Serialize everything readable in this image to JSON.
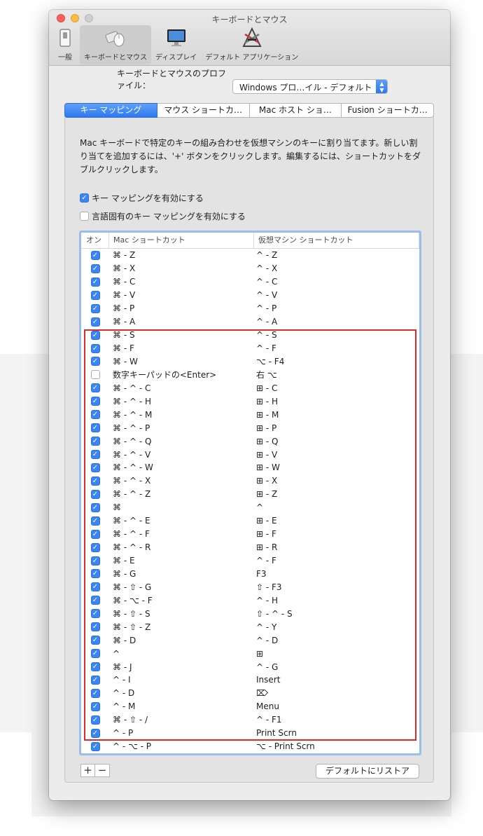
{
  "window": {
    "title": "キーボードとマウス"
  },
  "toolbar": {
    "items": [
      {
        "label": "一般",
        "icon": "general-switch-icon"
      },
      {
        "label": "キーボードとマウス",
        "icon": "keyboard-mouse-icon",
        "active": true
      },
      {
        "label": "ディスプレイ",
        "icon": "display-icon"
      },
      {
        "label": "デフォルト アプリケーション",
        "icon": "default-applications-icon"
      }
    ]
  },
  "profile": {
    "label": "キーボードとマウスのプロファイル：",
    "value": "Windows プロ…イル - デフォルト"
  },
  "tabs": [
    {
      "label": "キー マッピング",
      "selected": true
    },
    {
      "label": "マウス ショートカ…"
    },
    {
      "label": "Mac ホスト ショ…"
    },
    {
      "label": "Fusion ショートカ…"
    }
  ],
  "description": "Mac キーボードで特定のキーの組み合わせを仮想マシンのキーに割り当てます。新しい割り当てを追加するには、'+' ボタンをクリックします。編集するには、ショートカットをダブルクリックします。",
  "options": {
    "enable_mapping": {
      "label": "キー マッピングを有効にする",
      "checked": true
    },
    "enable_language": {
      "label": "言語固有のキー マッピングを有効にする",
      "checked": false
    }
  },
  "table": {
    "headers": {
      "on": "オン",
      "mac": "Mac ショートカット",
      "vm": "仮想マシン ショートカット"
    },
    "rows": [
      {
        "on": true,
        "mac": "⌘ - Z",
        "vm": "^ - Z"
      },
      {
        "on": true,
        "mac": "⌘ - X",
        "vm": "^ - X"
      },
      {
        "on": true,
        "mac": "⌘ - C",
        "vm": "^ - C"
      },
      {
        "on": true,
        "mac": "⌘ - V",
        "vm": "^ - V"
      },
      {
        "on": true,
        "mac": "⌘ - P",
        "vm": "^ - P"
      },
      {
        "on": true,
        "mac": "⌘ - A",
        "vm": "^ - A"
      },
      {
        "on": true,
        "mac": "⌘ - S",
        "vm": "^ - S"
      },
      {
        "on": true,
        "mac": "⌘ - F",
        "vm": "^ - F"
      },
      {
        "on": true,
        "mac": "⌘ - W",
        "vm": "⌥ - F4"
      },
      {
        "on": false,
        "mac": "数字キーパッドの<Enter>",
        "vm": "右 ⌥"
      },
      {
        "on": true,
        "mac": "⌘ - ^ - C",
        "vm": "⊞ - C"
      },
      {
        "on": true,
        "mac": "⌘ - ^ - H",
        "vm": "⊞ - H"
      },
      {
        "on": true,
        "mac": "⌘ - ^ - M",
        "vm": "⊞ - M"
      },
      {
        "on": true,
        "mac": "⌘ - ^ - P",
        "vm": "⊞ - P"
      },
      {
        "on": true,
        "mac": "⌘ - ^ - Q",
        "vm": "⊞ - Q"
      },
      {
        "on": true,
        "mac": "⌘ - ^ - V",
        "vm": "⊞ - V"
      },
      {
        "on": true,
        "mac": "⌘ - ^ - W",
        "vm": "⊞ - W"
      },
      {
        "on": true,
        "mac": "⌘ - ^ - X",
        "vm": "⊞ - X"
      },
      {
        "on": true,
        "mac": "⌘ - ^ - Z",
        "vm": "⊞ - Z"
      },
      {
        "on": true,
        "mac": "⌘",
        "vm": "^"
      },
      {
        "on": true,
        "mac": "⌘ - ^ - E",
        "vm": "⊞ - E"
      },
      {
        "on": true,
        "mac": "⌘ - ^ - F",
        "vm": "⊞ - F"
      },
      {
        "on": true,
        "mac": "⌘ - ^ - R",
        "vm": "⊞ - R"
      },
      {
        "on": true,
        "mac": "⌘ - E",
        "vm": "^ - F"
      },
      {
        "on": true,
        "mac": "⌘ - G",
        "vm": "F3"
      },
      {
        "on": true,
        "mac": "⌘ - ⇧ - G",
        "vm": "⇧ - F3"
      },
      {
        "on": true,
        "mac": "⌘ - ⌥ - F",
        "vm": "^ - H"
      },
      {
        "on": true,
        "mac": "⌘ - ⇧ - S",
        "vm": "⇧ - ^ - S"
      },
      {
        "on": true,
        "mac": "⌘ - ⇧ - Z",
        "vm": "^ - Y"
      },
      {
        "on": true,
        "mac": "⌘ - D",
        "vm": "^ - D"
      },
      {
        "on": true,
        "mac": "^",
        "vm": "⊞"
      },
      {
        "on": true,
        "mac": "⌘ - J",
        "vm": "^ - G"
      },
      {
        "on": true,
        "mac": "^ - I",
        "vm": "Insert"
      },
      {
        "on": true,
        "mac": "^ - D",
        "vm": "⌦"
      },
      {
        "on": true,
        "mac": "^ - M",
        "vm": "Menu"
      },
      {
        "on": true,
        "mac": "⌘ - ⇧ - /",
        "vm": "^ - F1"
      },
      {
        "on": true,
        "mac": "^ - P",
        "vm": "Print Scrn"
      },
      {
        "on": true,
        "mac": "^ - ⌥ - P",
        "vm": "⌥ - Print Scrn"
      }
    ]
  },
  "buttons": {
    "add": "+",
    "remove": "−",
    "restore": "デフォルトにリストア"
  },
  "colors": {
    "accent": "#3a85f5",
    "highlight": "#e02a2a"
  }
}
